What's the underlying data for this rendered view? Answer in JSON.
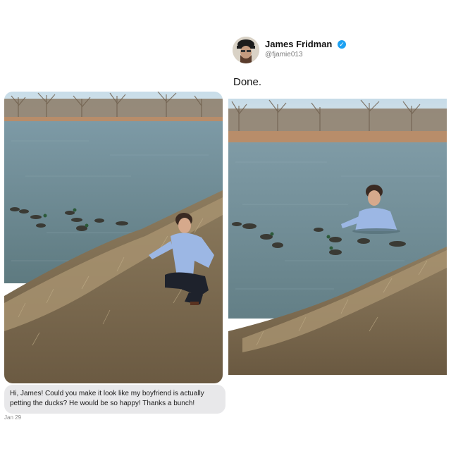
{
  "reply": {
    "author_name": "James Fridman",
    "author_handle": "@fjamie013",
    "text": "Done.",
    "verified_icon": "check-badge-icon"
  },
  "request": {
    "message": "Hi, James! Could you make it look like my boyfriend is actually petting the ducks? He would be so happy! Thanks a bunch!",
    "date": "Jan 29"
  },
  "colors": {
    "verified": "#1da1f2",
    "bubble": "#e8e8ea",
    "water": "#6f8f9b"
  }
}
